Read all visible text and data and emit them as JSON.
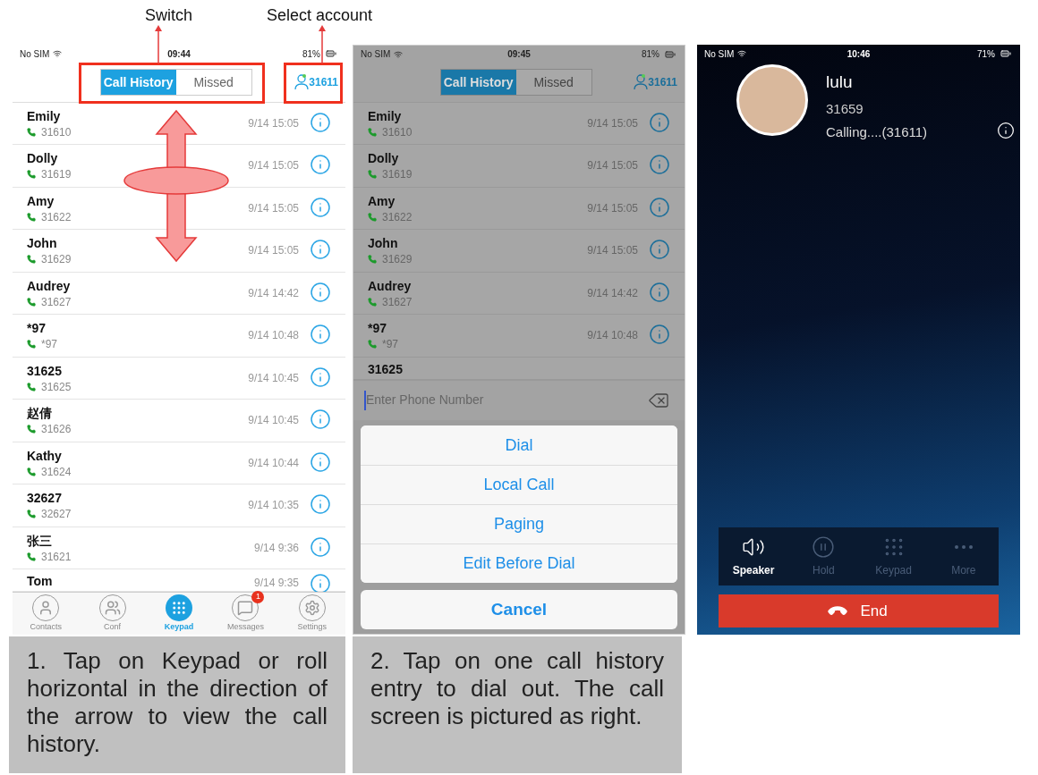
{
  "annotations": [
    {
      "label": "Switch"
    },
    {
      "label": "Select account"
    }
  ],
  "panels": [
    {
      "kind": "call_list",
      "status_bar": {
        "carrier": "No SIM",
        "time": "09:44",
        "battery": "81%"
      },
      "segments": [
        {
          "label": "Call History",
          "selected": true
        },
        {
          "label": "Missed",
          "selected": false
        }
      ],
      "account": "31611",
      "rows": [
        {
          "name": "Emily",
          "number": "31610",
          "time": "9/14 15:05"
        },
        {
          "name": "Dolly",
          "number": "31619",
          "time": "9/14 15:05"
        },
        {
          "name": "Amy",
          "number": "31622",
          "time": "9/14 15:05"
        },
        {
          "name": "John",
          "number": "31629",
          "time": "9/14 15:05"
        },
        {
          "name": "Audrey",
          "number": "31627",
          "time": "9/14 14:42"
        },
        {
          "name": "*97",
          "number": "*97",
          "time": "9/14 10:48"
        },
        {
          "name": "31625",
          "number": "31625",
          "time": "9/14 10:45"
        },
        {
          "name": "赵倩",
          "number": "31626",
          "time": "9/14 10:45"
        },
        {
          "name": "Kathy",
          "number": "31624",
          "time": "9/14 10:44"
        },
        {
          "name": "32627",
          "number": "32627",
          "time": "9/14 10:35"
        },
        {
          "name": "张三",
          "number": "31621",
          "time": "9/14 9:36"
        },
        {
          "name": "Tom",
          "time": "9/14 9:35"
        }
      ],
      "tab_bar": [
        {
          "label": "Contacts",
          "selected": false
        },
        {
          "label": "Conf",
          "selected": false
        },
        {
          "label": "Keypad",
          "selected": true
        },
        {
          "label": "Messages",
          "selected": false,
          "badge": "1"
        },
        {
          "label": "Settings",
          "selected": false
        }
      ],
      "caption": "1. Tap on Keypad or roll horizontal in the direction of the arrow to view the call history."
    },
    {
      "kind": "action_sheet",
      "status_bar": {
        "carrier": "No SIM",
        "time": "09:45",
        "battery": "81%"
      },
      "segments": [
        {
          "label": "Call History",
          "selected": true
        },
        {
          "label": "Missed",
          "selected": false
        }
      ],
      "account": "31611",
      "rows": [
        {
          "name": "Emily",
          "number": "31610",
          "time": "9/14 15:05"
        },
        {
          "name": "Dolly",
          "number": "31619",
          "time": "9/14 15:05"
        },
        {
          "name": "Amy",
          "number": "31622",
          "time": "9/14 15:05"
        },
        {
          "name": "John",
          "number": "31629",
          "time": "9/14 15:05"
        },
        {
          "name": "Audrey",
          "number": "31627",
          "time": "9/14 14:42"
        },
        {
          "name": "*97",
          "number": "*97",
          "time": "9/14 10:48"
        },
        {
          "name": "31625"
        }
      ],
      "input": {
        "placeholder": "Enter Phone Number"
      },
      "actions": [
        "Dial",
        "Local Call",
        "Paging",
        "Edit Before Dial"
      ],
      "cancel": "Cancel",
      "caption": "2. Tap on one call history entry to dial out. The call screen is pictured as right."
    },
    {
      "kind": "call_screen",
      "status_bar": {
        "carrier": "No SIM",
        "time": "10:46",
        "battery": "71%"
      },
      "contact": {
        "name": "lulu",
        "number": "31659",
        "status": "Calling....(31611)"
      },
      "controls": [
        {
          "kind": "speaker",
          "label": "Speaker",
          "enabled": true
        },
        {
          "kind": "hold",
          "label": "Hold",
          "enabled": false
        },
        {
          "kind": "keypad",
          "label": "Keypad",
          "enabled": false
        },
        {
          "kind": "more",
          "label": "More",
          "enabled": false
        }
      ],
      "end": "End"
    }
  ]
}
